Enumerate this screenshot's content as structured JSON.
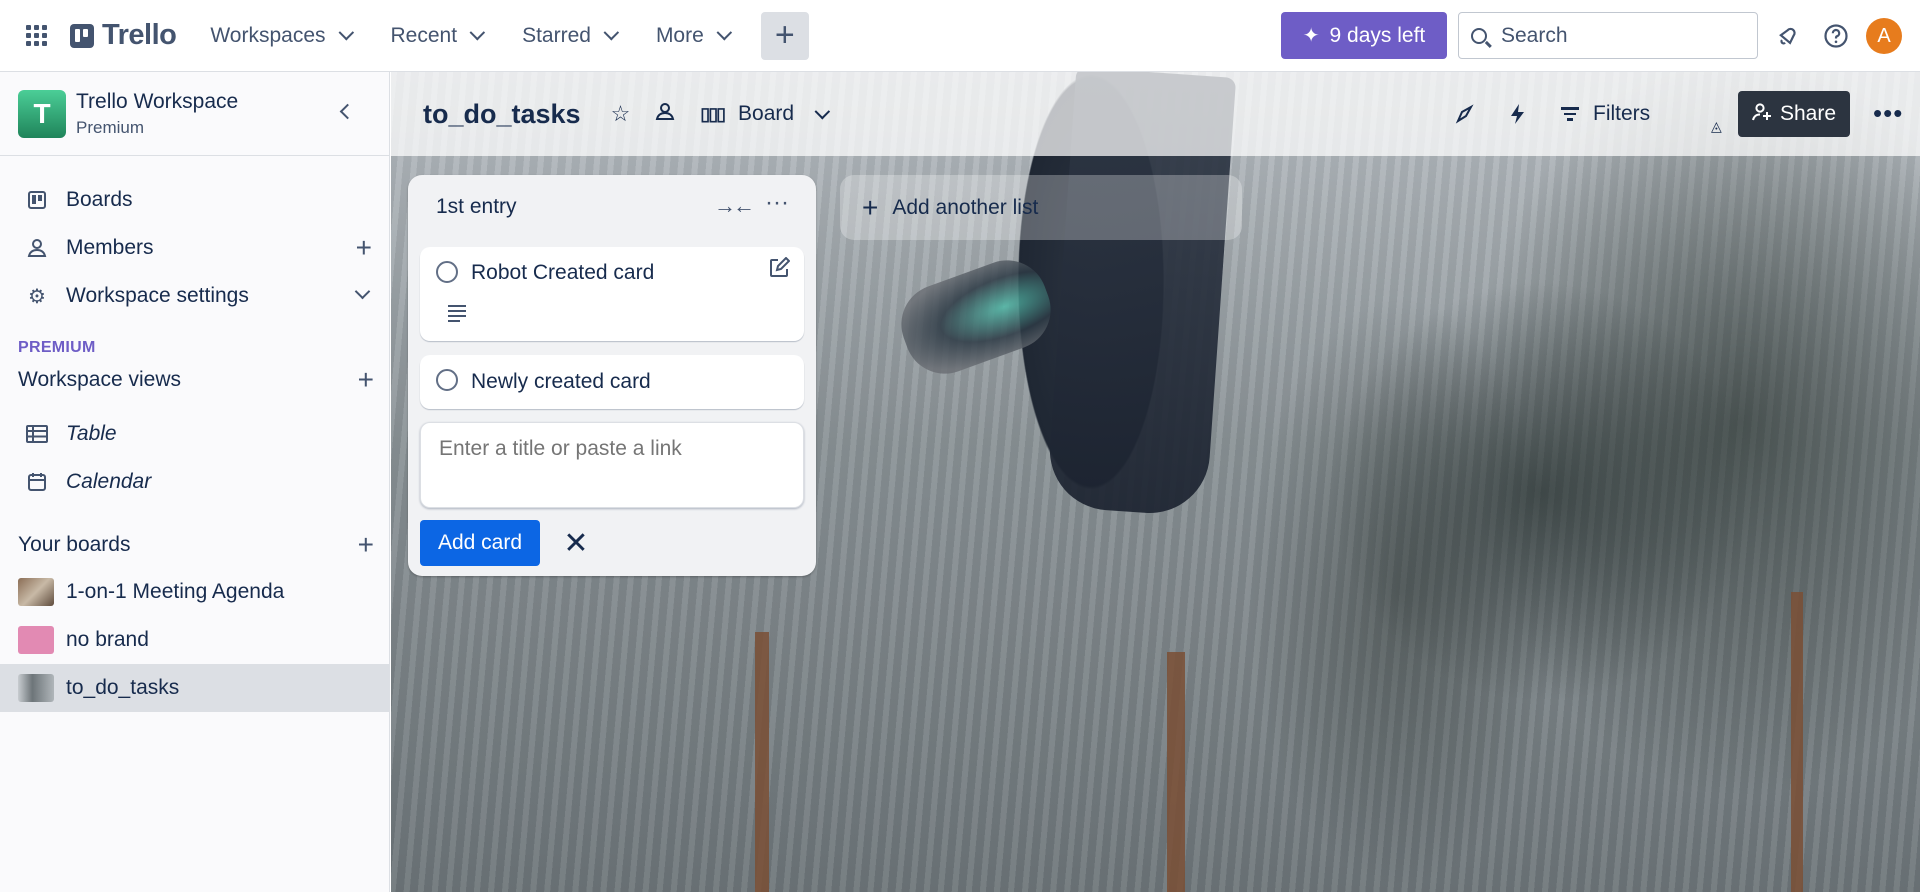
{
  "topnav": {
    "logo_text": "Trello",
    "menus": [
      "Workspaces",
      "Recent",
      "Starred",
      "More"
    ],
    "create_symbol": "+",
    "trial_label": "9 days left",
    "search_placeholder": "Search",
    "avatar_initial": "A",
    "icons": [
      "apps-grid-icon",
      "trello-logo-icon",
      "notifications-icon",
      "help-icon"
    ]
  },
  "sidebar": {
    "workspace": {
      "initial": "T",
      "name": "Trello Workspace",
      "plan": "Premium"
    },
    "items": [
      {
        "label": "Boards",
        "icon": "boards-icon"
      },
      {
        "label": "Members",
        "icon": "member-icon"
      },
      {
        "label": "Workspace settings",
        "icon": "gear-icon"
      }
    ],
    "premium_tag": "PREMIUM",
    "views_heading": "Workspace views",
    "views": [
      {
        "label": "Table",
        "icon": "table-icon"
      },
      {
        "label": "Calendar",
        "icon": "calendar-icon"
      }
    ],
    "boards_heading": "Your boards",
    "boards": [
      {
        "label": "1-on-1 Meeting Agenda",
        "color": "#8a6d55"
      },
      {
        "label": "no brand",
        "color": "#e28ab3"
      },
      {
        "label": "to_do_tasks",
        "color": "#9aa3a8",
        "active": true
      }
    ]
  },
  "board": {
    "title": "to_do_tasks",
    "view_label": "Board",
    "filters_label": "Filters",
    "share_label": "Share",
    "list": {
      "title": "1st entry",
      "cards": [
        {
          "title": "Robot Created card",
          "has_description": true
        },
        {
          "title": "Newly created card",
          "has_description": false
        }
      ],
      "composer_placeholder": "Enter a title or paste a link",
      "add_card_label": "Add card"
    },
    "add_list_label": "Add another list"
  },
  "colors": {
    "accent_blue": "#0c66e4",
    "trial_purple": "#6e5dc6",
    "premium_purple": "#6e5dc6",
    "workspace_green": "#1f845a",
    "avatar_orange": "#e77c1d"
  }
}
